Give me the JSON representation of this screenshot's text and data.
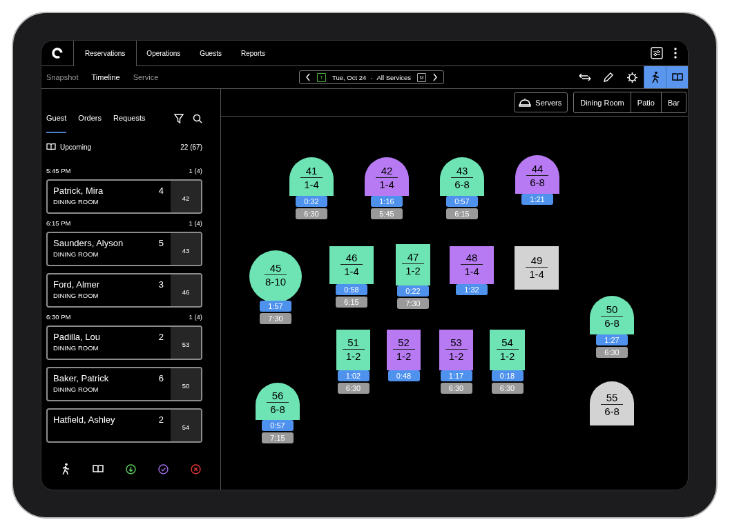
{
  "top_nav": {
    "tabs": [
      {
        "label": "Reservations",
        "selected": true
      },
      {
        "label": "Operations",
        "selected": false
      },
      {
        "label": "Guests",
        "selected": false
      },
      {
        "label": "Reports",
        "selected": false
      }
    ]
  },
  "sub_nav": {
    "views": [
      {
        "label": "Snapshot",
        "selected": false
      },
      {
        "label": "Timeline",
        "selected": true
      },
      {
        "label": "Service",
        "selected": false
      }
    ],
    "date_picker": {
      "today_badge": "T",
      "date": "Tue, Oct 24",
      "separator": "·",
      "service": "All Services",
      "month_badge": "M"
    },
    "tools": [
      {
        "kind": "swap",
        "selected": false
      },
      {
        "kind": "edit",
        "selected": false
      },
      {
        "kind": "brightness",
        "selected": false
      },
      {
        "kind": "walk-in",
        "selected": true
      },
      {
        "kind": "book",
        "selected": true
      }
    ]
  },
  "sidebar": {
    "tabs": [
      {
        "label": "Guest",
        "selected": true
      },
      {
        "label": "Orders",
        "selected": false
      },
      {
        "label": "Requests",
        "selected": false
      }
    ],
    "summary": {
      "label": "Upcoming",
      "count": "22 (67)"
    },
    "groups": [
      {
        "time": "5:45 PM",
        "count": "1 (4)",
        "reservations": [
          {
            "name": "Patrick, Mira",
            "party": "4",
            "area": "DINING ROOM",
            "table": "42"
          }
        ]
      },
      {
        "time": "6:15 PM",
        "count": "1 (4)",
        "reservations": [
          {
            "name": "Saunders, Alyson",
            "party": "5",
            "area": "DINING ROOM",
            "table": "43"
          },
          {
            "name": "Ford, Almer",
            "party": "3",
            "area": "DINING ROOM",
            "table": "46"
          }
        ]
      },
      {
        "time": "6:30 PM",
        "count": "1 (4)",
        "reservations": [
          {
            "name": "Padilla, Lou",
            "party": "2",
            "area": "DINING ROOM",
            "table": "53"
          },
          {
            "name": "Baker, Patrick",
            "party": "6",
            "area": "DINING ROOM",
            "table": "50"
          },
          {
            "name": "Hatfield, Ashley",
            "party": "2",
            "table": "54"
          }
        ]
      }
    ],
    "footer_actions": [
      {
        "kind": "walk-in"
      },
      {
        "kind": "book"
      },
      {
        "kind": "arrived"
      },
      {
        "kind": "done"
      },
      {
        "kind": "cancel"
      }
    ]
  },
  "floor": {
    "servers_label": "Servers",
    "rooms": [
      {
        "label": "Dining Room"
      },
      {
        "label": "Patio"
      },
      {
        "label": "Bar"
      }
    ],
    "tables": [
      {
        "number": "41",
        "seats": "1-4",
        "kind": "arch",
        "color": "#6ee3b4",
        "timer": "0:32",
        "time": "6:30"
      },
      {
        "number": "42",
        "seats": "1-4",
        "kind": "arch",
        "color": "#b77af2",
        "timer": "1:16",
        "time": "5:45"
      },
      {
        "number": "43",
        "seats": "6-8",
        "kind": "arch",
        "color": "#6ee3b4",
        "timer": "0:57",
        "time": "6:15"
      },
      {
        "number": "44",
        "seats": "6-8",
        "kind": "arch",
        "color": "#b77af2",
        "timer": "1:21"
      },
      {
        "number": "45",
        "seats": "8-10",
        "kind": "circle",
        "color": "#6ee3b4",
        "timer": "1:57",
        "time": "7:30"
      },
      {
        "number": "46",
        "seats": "1-4",
        "kind": "square",
        "color": "#6ee3b4",
        "timer": "0:58",
        "time": "6:15"
      },
      {
        "number": "47",
        "seats": "1-2",
        "kind": "square",
        "color": "#6ee3b4",
        "timer": "0:22",
        "time": "7:30"
      },
      {
        "number": "48",
        "seats": "1-4",
        "kind": "square",
        "color": "#b77af2",
        "timer": "1:32"
      },
      {
        "number": "49",
        "seats": "1-4",
        "kind": "square",
        "color": "#d3d3d3"
      },
      {
        "number": "50",
        "seats": "6-8",
        "kind": "arch",
        "color": "#6ee3b4",
        "timer": "1:27",
        "time": "6:30"
      },
      {
        "number": "51",
        "seats": "1-2",
        "kind": "square",
        "color": "#6ee3b4",
        "timer": "1:02",
        "time": "6:30"
      },
      {
        "number": "52",
        "seats": "1-2",
        "kind": "square",
        "color": "#b77af2",
        "timer": "0:48"
      },
      {
        "number": "53",
        "seats": "1-2",
        "kind": "square",
        "color": "#b77af2",
        "timer": "1:17",
        "time": "6:30"
      },
      {
        "number": "54",
        "seats": "1-2",
        "kind": "square",
        "color": "#6ee3b4",
        "timer": "0:18",
        "time": "6:30"
      },
      {
        "number": "55",
        "seats": "6-8",
        "kind": "arch",
        "color": "#d3d3d3"
      },
      {
        "number": "56",
        "seats": "6-8",
        "kind": "arch",
        "color": "#6ee3b4",
        "timer": "0:57",
        "time": "7:15"
      }
    ]
  }
}
